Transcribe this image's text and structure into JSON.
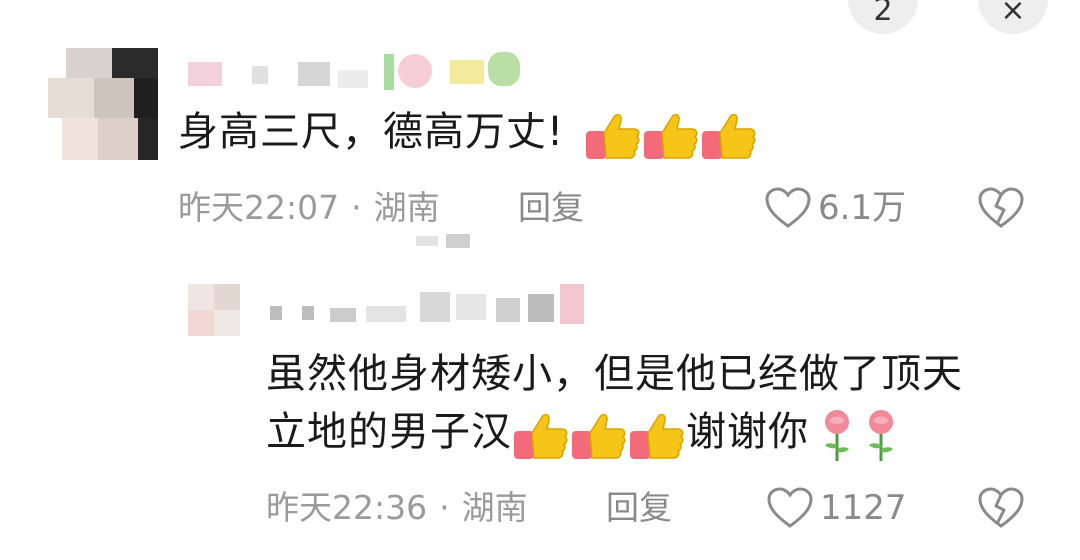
{
  "top_buttons": {
    "left_glyph": "2",
    "right_glyph": "×"
  },
  "comments": [
    {
      "text": "身高三尺，德高万丈!",
      "emoji": "thumbs-up-icon",
      "emoji_count": 3,
      "time": "昨天22:07",
      "location": "湖南",
      "reply_label": "回复",
      "likes": "6.1万"
    },
    {
      "text_line1": "虽然他身材矮小，但是他已经做了顶天",
      "text_line2_a": "立地的男子汉",
      "text_line2_b": "谢谢你",
      "emoji": "thumbs-up-icon",
      "emoji_count": 3,
      "emoji_after": "rose-icon",
      "emoji_after_count": 2,
      "time": "昨天22:36",
      "location": "湖南",
      "reply_label": "回复",
      "likes": "1127"
    }
  ],
  "meta_separator": "·",
  "colors": {
    "text": "#1a1a1a",
    "meta": "#9a9a9a",
    "thumb": "#f5c518",
    "sleeve": "#f36b7a",
    "rose": "#f08a98"
  }
}
